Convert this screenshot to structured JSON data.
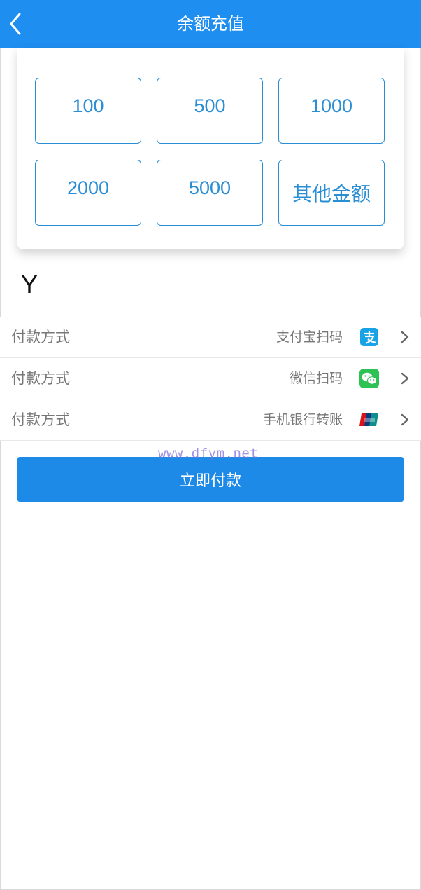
{
  "header": {
    "title": "余额充值",
    "back_icon": "chevron-left-icon"
  },
  "amounts": [
    {
      "label": "100"
    },
    {
      "label": "500"
    },
    {
      "label": "1000"
    },
    {
      "label": "2000"
    },
    {
      "label": "5000"
    },
    {
      "label": "其他金额"
    }
  ],
  "currency_symbol": "Y",
  "payment_rows": [
    {
      "label": "付款方式",
      "method": "支付宝扫码",
      "icon": "alipay-icon"
    },
    {
      "label": "付款方式",
      "method": "微信扫码",
      "icon": "wechat-icon"
    },
    {
      "label": "付款方式",
      "method": "手机银行转账",
      "icon": "unionpay-icon"
    }
  ],
  "submit_label": "立即付款",
  "watermark": "www.dfym.net",
  "colors": {
    "header_bg": "#1e8ef1",
    "accent": "#2a8ed4",
    "submit_bg": "#1e8ae8"
  }
}
